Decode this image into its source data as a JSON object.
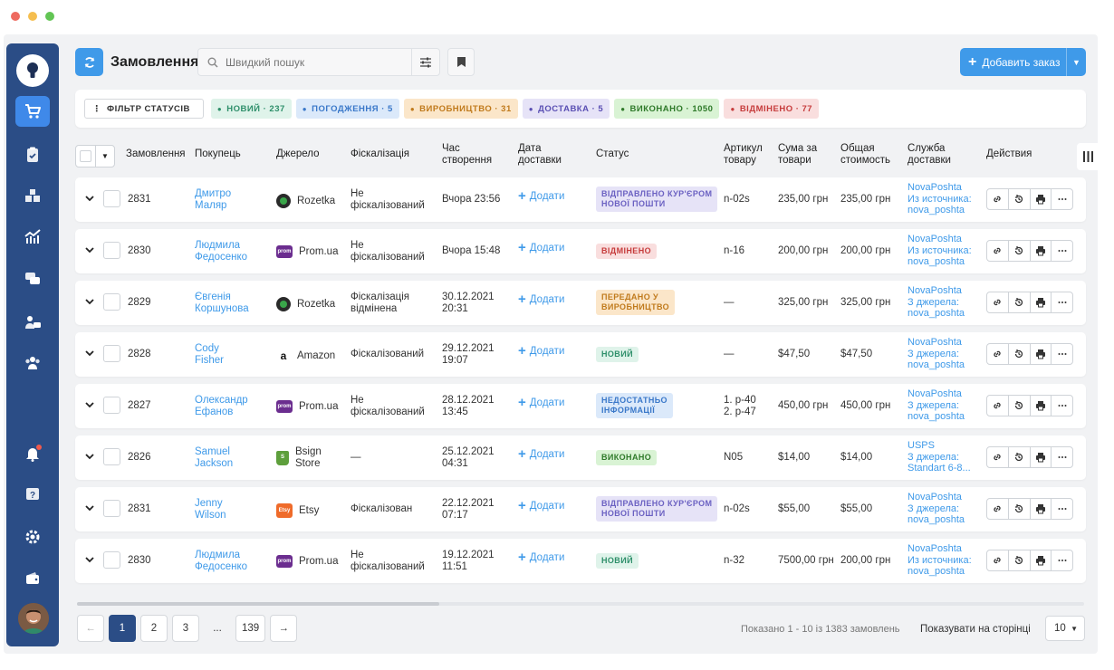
{
  "window": {
    "dot_colors": [
      "#ee6a5f",
      "#f5be4f",
      "#62c554"
    ]
  },
  "sidebar": {
    "items": [
      {
        "icon": "cart-icon"
      },
      {
        "icon": "clipboard-icon"
      },
      {
        "icon": "boxes-icon"
      },
      {
        "icon": "analytics-icon"
      },
      {
        "icon": "chat-icon"
      },
      {
        "icon": "support-icon"
      },
      {
        "icon": "users-icon"
      },
      {
        "icon": "bell-icon"
      },
      {
        "icon": "help-icon"
      },
      {
        "icon": "gear-icon"
      },
      {
        "icon": "wallet-icon"
      }
    ]
  },
  "header": {
    "title": "Замовлення",
    "search_placeholder": "Швидкий пошук",
    "add_order_label": "Добавить заказ"
  },
  "status_filter": {
    "label": "ФІЛЬТР СТАТУСІВ",
    "chips": [
      {
        "label": "НОВИЙ · 237",
        "bg": "#dff3ea",
        "fg": "#2e8f6a"
      },
      {
        "label": "ПОГОДЖЕННЯ · 5",
        "bg": "#dbe9fa",
        "fg": "#3a78c9"
      },
      {
        "label": "ВИРОБНИЦТВО · 31",
        "bg": "#fbe6c9",
        "fg": "#c07a1c"
      },
      {
        "label": "ДОСТАВКА · 5",
        "bg": "#e6e3f7",
        "fg": "#5a4fb3"
      },
      {
        "label": "ВИКОНАНО · 1050",
        "bg": "#d9f3d4",
        "fg": "#2f7a2a"
      },
      {
        "label": "ВІДМІНЕНО · 77",
        "bg": "#f9dede",
        "fg": "#c63c3c"
      }
    ]
  },
  "table": {
    "headers": {
      "order": "Замовлення",
      "buyer": "Покупець",
      "source": "Джерело",
      "fiscal": "Фіскалізація",
      "created_1": "Час",
      "created_2": "створення",
      "delivery_1": "Дата",
      "delivery_2": "доставки",
      "status": "Статус",
      "sku_1": "Артикул",
      "sku_2": "товару",
      "sum_1": "Сума за",
      "sum_2": "товари",
      "total_1": "Общая",
      "total_2": "стоимость",
      "ship_1": "Служба",
      "ship_2": "доставки",
      "actions": "Действия"
    },
    "add_label": "Додати",
    "rows": [
      {
        "id": "2831",
        "buyer1": "Дмитро",
        "buyer2": "Маляр",
        "source": "Rozetka",
        "source2": "",
        "icon_kind": "rozetka",
        "fiscal1": "Не",
        "fiscal2": "фіскалізований",
        "created1": "Вчора 23:56",
        "created2": "",
        "status1": "ВІДПРАВЛЕНО КУР'ЄРОМ",
        "status2": "НОВОЇ ПОШТИ",
        "status_bg": "#e6e3f7",
        "status_fg": "#6b61c2",
        "sku1": "n-02s",
        "sku2": "",
        "sum": "235,00 грн",
        "total": "235,00 грн",
        "ship1": "NovaPoshta",
        "ship2": "Из источника:",
        "ship3": "nova_poshta"
      },
      {
        "id": "2830",
        "buyer1": "Людмила",
        "buyer2": "Федосенко",
        "source": "Prom.ua",
        "source2": "",
        "icon_kind": "prom",
        "fiscal1": "Не",
        "fiscal2": "фіскалізований",
        "created1": "Вчора 15:48",
        "created2": "",
        "status1": "ВІДМІНЕНО",
        "status2": "",
        "status_bg": "#f9dede",
        "status_fg": "#c63c3c",
        "sku1": "n-16",
        "sku2": "",
        "sum": "200,00 грн",
        "total": "200,00 грн",
        "ship1": "NovaPoshta",
        "ship2": "Из источника:",
        "ship3": "nova_poshta"
      },
      {
        "id": "2829",
        "buyer1": "Євгенія",
        "buyer2": "Коршунова",
        "source": "Rozetka",
        "source2": "",
        "icon_kind": "rozetka",
        "fiscal1": "Фіскалізація",
        "fiscal2": "відмінена",
        "created1": "30.12.2021",
        "created2": "20:31",
        "status1": "ПЕРЕДАНО У",
        "status2": "ВИРОБНИЦТВО",
        "status_bg": "#fbe6c9",
        "status_fg": "#c07a1c",
        "sku1": "—",
        "sku2": "",
        "sum": "325,00 грн",
        "total": "325,00 грн",
        "ship1": "NovaPoshta",
        "ship2": "З джерела:",
        "ship3": "nova_poshta"
      },
      {
        "id": "2828",
        "buyer1": "Cody",
        "buyer2": "Fisher",
        "source": "Amazon",
        "source2": "",
        "icon_kind": "amazon",
        "fiscal1": "Фіскалізований",
        "fiscal2": "",
        "created1": "29.12.2021",
        "created2": "19:07",
        "status1": "НОВИЙ",
        "status2": "",
        "status_bg": "#dff3ea",
        "status_fg": "#2e8f6a",
        "sku1": "—",
        "sku2": "",
        "sum": "$47,50",
        "total": "$47,50",
        "ship1": "NovaPoshta",
        "ship2": "З джерела:",
        "ship3": "nova_poshta"
      },
      {
        "id": "2827",
        "buyer1": "Олександр",
        "buyer2": "Ефанов",
        "source": "Prom.ua",
        "source2": "",
        "icon_kind": "prom",
        "fiscal1": "Не",
        "fiscal2": "фіскалізований",
        "created1": "28.12.2021",
        "created2": "13:45",
        "status1": "НЕДОСТАТНЬО",
        "status2": "ІНФОРМАЦІЇ",
        "status_bg": "#dbe9fa",
        "status_fg": "#3a78c9",
        "sku1": "1. p-40",
        "sku2": "2. p-47",
        "sum": "450,00 грн",
        "total": "450,00 грн",
        "ship1": "NovaPoshta",
        "ship2": "З джерела:",
        "ship3": "nova_poshta"
      },
      {
        "id": "2826",
        "buyer1": "Samuel",
        "buyer2": "Jackson",
        "source": "Bsign",
        "source2": "Store",
        "icon_kind": "shopify",
        "fiscal1": "—",
        "fiscal2": "",
        "created1": "25.12.2021",
        "created2": "04:31",
        "status1": "ВИКОНАНО",
        "status2": "",
        "status_bg": "#d9f3d4",
        "status_fg": "#2f7a2a",
        "sku1": "N05",
        "sku2": "",
        "sum": "$14,00",
        "total": "$14,00",
        "ship1": "USPS",
        "ship2": "З джерела:",
        "ship3": "Standart 6-8..."
      },
      {
        "id": "2831",
        "buyer1": "Jenny",
        "buyer2": "Wilson",
        "source": "Etsy",
        "source2": "",
        "icon_kind": "etsy",
        "fiscal1": "Фіскалізован",
        "fiscal2": "",
        "created1": "22.12.2021",
        "created2": "07:17",
        "status1": "ВІДПРАВЛЕНО КУР'ЄРОМ",
        "status2": "НОВОЇ ПОШТИ",
        "status_bg": "#e6e3f7",
        "status_fg": "#6b61c2",
        "sku1": "n-02s",
        "sku2": "",
        "sum": "$55,00",
        "total": "$55,00",
        "ship1": "NovaPoshta",
        "ship2": "З джерела:",
        "ship3": "nova_poshta"
      },
      {
        "id": "2830",
        "buyer1": "Людмила",
        "buyer2": "Федосенко",
        "source": "Prom.ua",
        "source2": "",
        "icon_kind": "prom",
        "fiscal1": "Не",
        "fiscal2": "фіскалізований",
        "created1": "19.12.2021",
        "created2": "11:51",
        "status1": "НОВИЙ",
        "status2": "",
        "status_bg": "#dff3ea",
        "status_fg": "#2e8f6a",
        "sku1": "n-32",
        "sku2": "",
        "sum": "7500,00 грн",
        "total": "200,00 грн",
        "ship1": "NovaPoshta",
        "ship2": "Из источника:",
        "ship3": "nova_poshta"
      }
    ]
  },
  "pagination": {
    "pages": [
      "1",
      "2",
      "3",
      "...",
      "139"
    ],
    "current": "1",
    "shown_text": "Показано 1 - 10 із 1383 замовлень",
    "per_page_label": "Показувати на сторінці",
    "per_page_value": "10"
  },
  "colors": {
    "sidebar": "#2b4d86",
    "accent": "#3f9ae9",
    "link": "#3f9ae9"
  }
}
